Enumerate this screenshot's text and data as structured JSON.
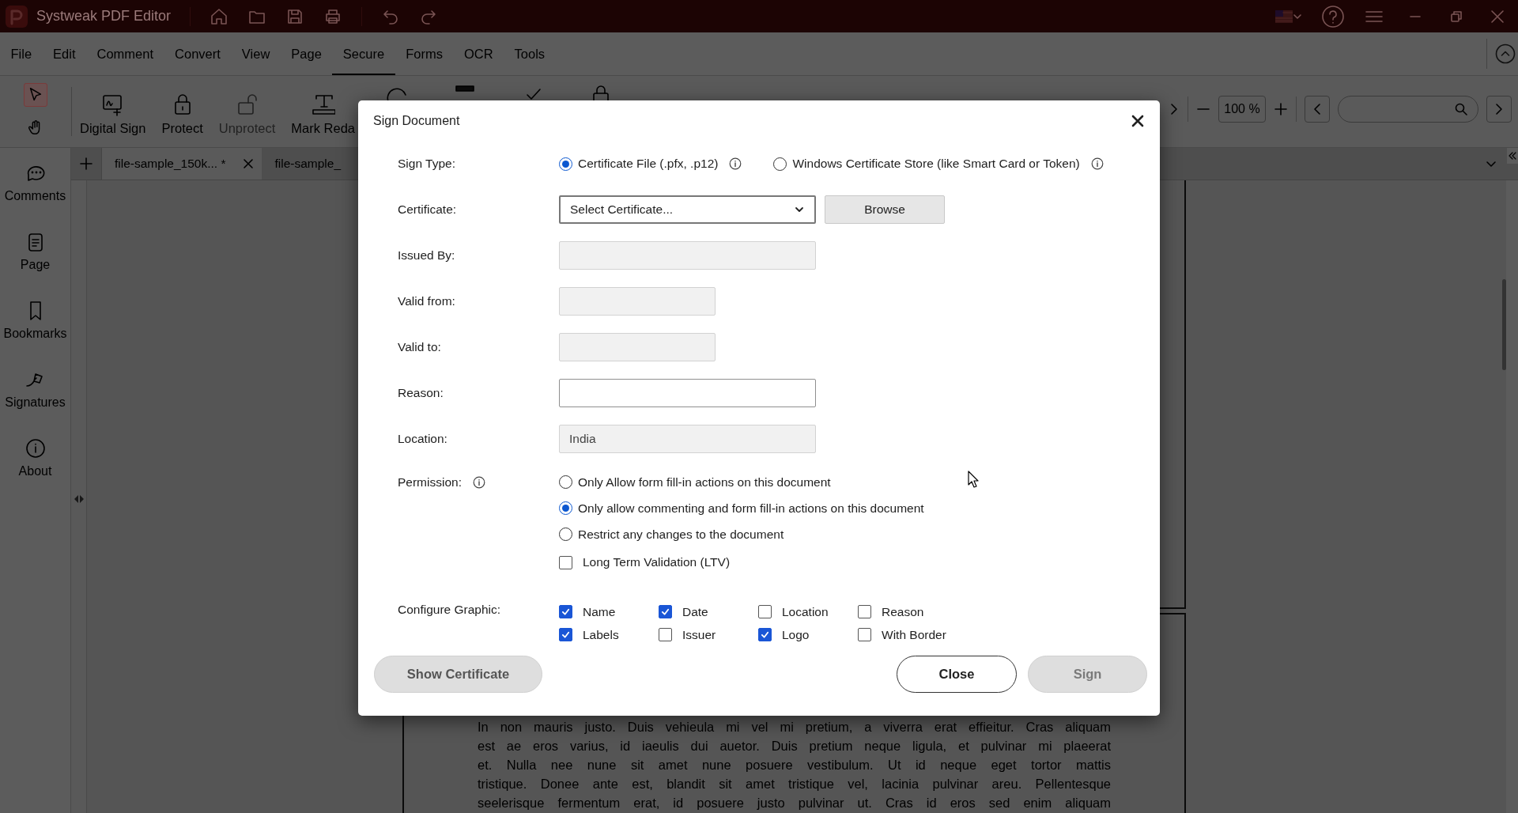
{
  "app": {
    "title": "Systweak PDF Editor"
  },
  "menu": [
    {
      "label": "File",
      "selected": false
    },
    {
      "label": "Edit",
      "selected": false
    },
    {
      "label": "Comment",
      "selected": false
    },
    {
      "label": "Convert",
      "selected": false
    },
    {
      "label": "View",
      "selected": false
    },
    {
      "label": "Page",
      "selected": false
    },
    {
      "label": "Secure",
      "selected": true
    },
    {
      "label": "Forms",
      "selected": false
    },
    {
      "label": "OCR",
      "selected": false
    },
    {
      "label": "Tools",
      "selected": false
    }
  ],
  "toolbar": {
    "modes": [
      {
        "kind": "select",
        "selected": true
      },
      {
        "kind": "hand",
        "selected": false
      }
    ],
    "tools": [
      {
        "label": "Digital Sign",
        "disabled": false
      },
      {
        "label": "Protect",
        "disabled": false
      },
      {
        "label": "Unprotect",
        "disabled": true
      },
      {
        "label": "Mark Reda",
        "disabled": false
      }
    ],
    "zoom": "100 %"
  },
  "tabs": [
    {
      "label": "file-sample_150k... *",
      "selected": true
    },
    {
      "label": "file-sample_",
      "selected": false
    }
  ],
  "sidebar": [
    {
      "label": "Comments"
    },
    {
      "label": "Page"
    },
    {
      "label": "Bookmarks"
    },
    {
      "label": "Signatures"
    },
    {
      "label": "About"
    }
  ],
  "document": {
    "lines": [
      "In non mauris justo. Duis vehieula mi vel mi pretium, a viverra erat effieitur. Cras aliquam",
      "est ae eros varius, id iaeulis dui auetor. Duis pretium neque ligula, et pulvinar mi plaeerat",
      "et. Nulla nee nune sit amet nune posuere vestibulum. Ut id neque eget tortor mattis",
      "tristique. Donee ante est, blandit sit amet tristique vel, lacinia pulvinar areu. Pellentesque",
      "seelerisque fermentum erat, id posuere justo pulvinar ut. Cras id eros sed enim aliquam"
    ]
  },
  "dialog": {
    "title": "Sign Document",
    "sign_type": {
      "label": "Sign Type:",
      "options": [
        {
          "label": "Certificate File (.pfx, .p12)",
          "selected": true
        },
        {
          "label": "Windows Certificate Store (like Smart Card or Token)",
          "selected": false
        }
      ]
    },
    "fields": [
      {
        "kind": "select",
        "label": "Certificate:",
        "value": "Select Certificate...",
        "button": "Browse"
      },
      {
        "kind": "text",
        "label": "Issued By:",
        "disabled": true
      },
      {
        "kind": "short",
        "label": "Valid from:",
        "disabled": true
      },
      {
        "kind": "short",
        "label": "Valid to:",
        "disabled": true
      },
      {
        "kind": "text",
        "label": "Reason:",
        "disabled": false
      },
      {
        "kind": "text",
        "label": "Location:",
        "value": "India",
        "disabled": true
      }
    ],
    "permission": {
      "label": "Permission:",
      "options": [
        {
          "label": "Only Allow form fill-in actions on this document",
          "selected": false
        },
        {
          "label": "Only allow commenting and form fill-in actions on this document",
          "selected": true
        },
        {
          "label": "Restrict any changes to the document",
          "selected": false
        }
      ],
      "ltv": {
        "label": "Long Term Validation (LTV)",
        "checked": false
      }
    },
    "graphic": {
      "label": "Configure Graphic:",
      "options": [
        {
          "label": "Name",
          "checked": true
        },
        {
          "label": "Date",
          "checked": true
        },
        {
          "label": "Location",
          "checked": false
        },
        {
          "label": "Reason",
          "checked": false
        },
        {
          "label": "Labels",
          "checked": true
        },
        {
          "label": "Issuer",
          "checked": false
        },
        {
          "label": "Logo",
          "checked": true
        },
        {
          "label": "With Border",
          "checked": false
        }
      ]
    },
    "buttons": [
      {
        "label": "Show Certificate",
        "disabled": true
      },
      {
        "label": "Close",
        "disabled": false
      },
      {
        "label": "Sign",
        "disabled": true
      }
    ]
  }
}
